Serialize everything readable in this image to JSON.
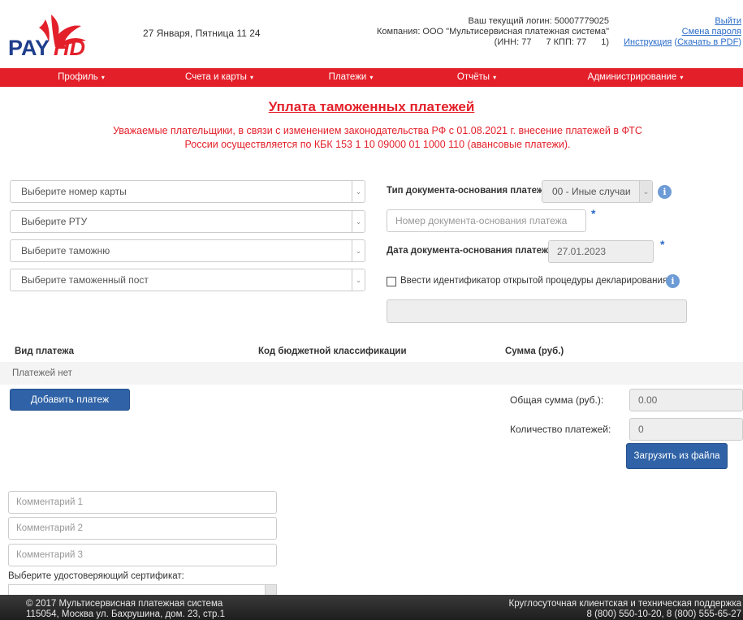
{
  "header": {
    "logo_text": "PAYHD",
    "date": "27 Января, Пятница 11 24",
    "login": "Ваш текущий логин: 50007779025",
    "company": "Компания: ООО \"Мультисервисная платежная система\"",
    "inn": "(ИНН: 77",
    "kpp": "7 КПП: 77",
    "kpp_end": "1)",
    "logout": "Выйти",
    "change_password": "Смена пароля",
    "instruction": "Инструкция",
    "download_pdf": "Скачать в PDF",
    "instruction_sep_open": " (",
    "instruction_sep_close": ")"
  },
  "nav": {
    "items": [
      {
        "label": "Профиль"
      },
      {
        "label": "Счета и карты"
      },
      {
        "label": "Платежи"
      },
      {
        "label": "Отчёты"
      },
      {
        "label": "Администрирование"
      }
    ],
    "caret": "▾"
  },
  "page": {
    "title": "Уплата таможенных платежей",
    "notice_line1": "Уважаемые плательщики, в связи с изменением законодательства РФ с 01.08.2021 г. внесение платежей в ФТС",
    "notice_line2": "России осуществляется по КБК 153 1 10 09000 01 1000 110 (авансовые платежи)."
  },
  "form": {
    "card_select": "Выберите номер карты",
    "rtu_select": "Выберите РТУ",
    "customs_select": "Выберите таможню",
    "post_select": "Выберите таможенный пост",
    "doc_type_label": "Тип документа-основания платежа",
    "doc_type_value": "00 - Иные случаи",
    "doc_number_placeholder": "Номер документа-основания платежа",
    "doc_date_label": "Дата документа-основания платежа",
    "doc_date_value": "27.01.2023",
    "declaration_checkbox_label": "Ввести идентификатор открытой процедуры декларирования",
    "declaration_input_value": "",
    "required_mark": "*",
    "info_glyph": "i",
    "select_arrow": "⌄"
  },
  "table": {
    "columns": [
      "Вид платежа",
      "Код бюджетной классификации",
      "Сумма (руб.)"
    ],
    "empty_text": "Платежей нет"
  },
  "actions": {
    "add_payment": "Добавить платеж",
    "total_label": "Общая сумма (руб.):",
    "total_value": "0.00",
    "count_label": "Количество платежей:",
    "count_value": "0",
    "upload_file": "Загрузить из файла"
  },
  "comments": {
    "c1_placeholder": "Комментарий 1",
    "c2_placeholder": "Комментарий 2",
    "c3_placeholder": "Комментарий 3",
    "cert_label": "Выберите удостоверяющий сертификат:"
  },
  "footer": {
    "copyright": "© 2017 Мультисервисная платежная система",
    "address": "115054, Москва ул. Бахрушина, дом. 23, стр.1",
    "support_label": "Круглосуточная клиентская и техническая поддержка",
    "support_phones": "8 (800) 550-10-20, 8 (800) 555-65-27"
  },
  "colors": {
    "brand_red": "#e3202a",
    "link_blue": "#2a6cc8",
    "button_blue": "#2f62a6",
    "footer_dark": "#2b2b2b"
  }
}
